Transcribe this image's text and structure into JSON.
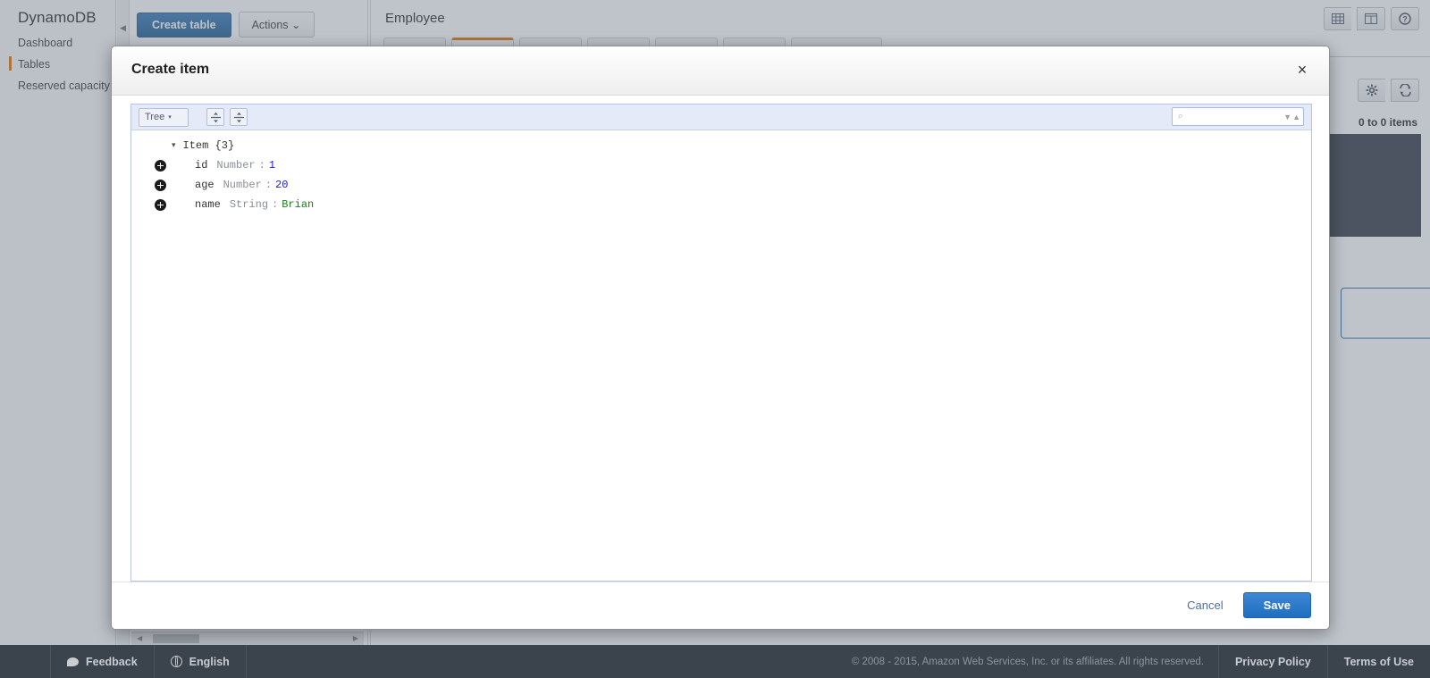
{
  "sidebar": {
    "brand": "DynamoDB",
    "items": [
      {
        "label": "Dashboard",
        "active": false
      },
      {
        "label": "Tables",
        "active": true
      },
      {
        "label": "Reserved capacity",
        "active": false
      }
    ]
  },
  "background": {
    "create_table_label": "Create table",
    "actions_label": "Actions",
    "actions_caret": "⌄",
    "collapse_handle_icon": "◀",
    "panel_title": "Employee",
    "items_count_text": "0 to 0 items",
    "icons": {
      "grid_view": "grid-view-icon",
      "split_view": "split-view-icon",
      "help": "?",
      "settings": "⚙",
      "refresh": "↻"
    },
    "scroll_left_arrow": "◀",
    "scroll_right_arrow": "▶"
  },
  "modal": {
    "title": "Create item",
    "close_label": "×",
    "toolbar": {
      "mode_label": "Tree",
      "mode_caret": "▾",
      "expand_all_title": "expand-all",
      "collapse_all_title": "collapse-all",
      "search_placeholder": "",
      "search_value": "",
      "search_icon": "⌕",
      "nav_down": "▼",
      "nav_up": "▲"
    },
    "tree": {
      "root_caret": "▾",
      "root_label": "Item {3}",
      "rows": [
        {
          "key": "id",
          "type": "Number",
          "colon": ":",
          "value": "1",
          "value_kind": "number"
        },
        {
          "key": "age",
          "type": "Number",
          "colon": ":",
          "value": "20",
          "value_kind": "number"
        },
        {
          "key": "name",
          "type": "String",
          "colon": ":",
          "value": "Brian",
          "value_kind": "string"
        }
      ]
    },
    "footer": {
      "cancel_label": "Cancel",
      "save_label": "Save"
    }
  },
  "statusbar": {
    "feedback_label": "Feedback",
    "language_label": "English",
    "copyright": "© 2008 - 2015, Amazon Web Services, Inc. or its affiliates. All rights reserved.",
    "privacy_label": "Privacy Policy",
    "terms_label": "Terms of Use"
  },
  "colors": {
    "accent_orange": "#e47911",
    "primary_blue": "#2e6da4",
    "save_blue": "#1f6ec0",
    "value_number": "#1a1ad8",
    "value_string": "#178217",
    "statusbar_bg": "#3b434d"
  }
}
